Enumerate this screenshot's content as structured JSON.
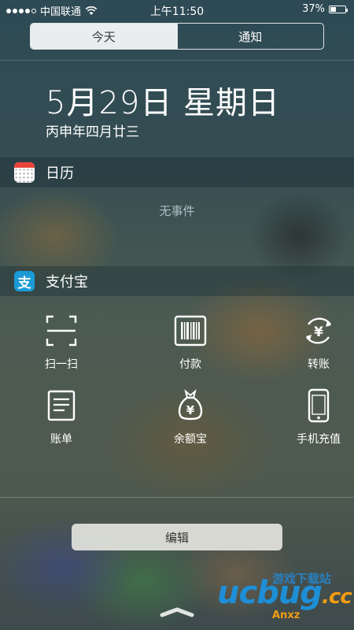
{
  "status_bar": {
    "carrier": "中国联通",
    "time": "上午11:50",
    "battery_percent": "37%",
    "battery_level": 0.37,
    "signal_bars": 4,
    "signal_max": 5
  },
  "tabs": [
    {
      "label": "今天",
      "active": true
    },
    {
      "label": "通知",
      "active": false
    }
  ],
  "date": {
    "main": "5月29日 星期日",
    "lunar": "丙申年四月廿三"
  },
  "calendar": {
    "title": "日历",
    "empty_text": "无事件"
  },
  "alipay": {
    "title": "支付宝",
    "icon_glyph": "支",
    "brand_color": "#1a9bd7",
    "actions": [
      {
        "label": "扫一扫",
        "icon": "scan-icon"
      },
      {
        "label": "付款",
        "icon": "barcode-icon"
      },
      {
        "label": "转账",
        "icon": "transfer-icon"
      },
      {
        "label": "账单",
        "icon": "bill-icon"
      },
      {
        "label": "余额宝",
        "icon": "money-bag-icon"
      },
      {
        "label": "手机充值",
        "icon": "phone-icon"
      }
    ]
  },
  "edit_button": "编辑",
  "watermark": {
    "main": "ucbug",
    "suffix": ".cc",
    "top": "游戏下载站",
    "sub": "Anxz"
  }
}
